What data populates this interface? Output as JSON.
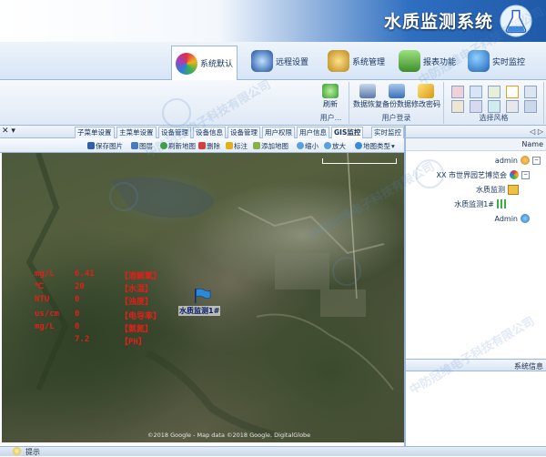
{
  "app": {
    "title": "水质监测系统"
  },
  "modules": [
    {
      "id": "realtime",
      "label": "实时监控",
      "icon": "globe-icon",
      "color": "#2e7fd8"
    },
    {
      "id": "report",
      "label": "报表功能",
      "icon": "report-icon",
      "color": "#4a9c3a"
    },
    {
      "id": "manage",
      "label": "系统管理",
      "icon": "manage-icon",
      "color": "#c89a20"
    },
    {
      "id": "remote",
      "label": "远程设置",
      "icon": "remote-icon",
      "color": "#2a5fb6"
    },
    {
      "id": "skin",
      "label": "系统默认",
      "icon": "palette-icon",
      "color": "#d0407a",
      "active": true
    }
  ],
  "ribbon": {
    "groups": [
      {
        "title": "选择风格"
      },
      {
        "title": "用户登录"
      },
      {
        "title": "用户..."
      }
    ],
    "buttons": [
      {
        "label": "修改密码",
        "icon": "key-icon"
      },
      {
        "label": "备份数据",
        "icon": "backup-icon"
      },
      {
        "label": "数据恢复",
        "icon": "restore-icon"
      },
      {
        "label": "刷新",
        "icon": "refresh-icon"
      }
    ]
  },
  "doc_tabs": [
    "GIS监控",
    "用户信息",
    "用户权限",
    "设备管理",
    "设备信息",
    "设备管理",
    "主菜单设置",
    "子菜单设置"
  ],
  "map_toolbar": [
    "地图类型",
    "放大",
    "缩小",
    "添加地图",
    "标注",
    "删除",
    "刷新地图",
    "图层",
    "保存图片"
  ],
  "tree": {
    "tabs": [
      "Name"
    ],
    "nodes": [
      {
        "label": "admin",
        "level": 0
      },
      {
        "label": "XX 市世界园艺博览会",
        "level": 1
      },
      {
        "label": "水质监测",
        "level": 2
      },
      {
        "label": "水质监测1#",
        "level": 3
      },
      {
        "label": "Admin",
        "level": 1
      }
    ],
    "sysinfo": "系统信息"
  },
  "map": {
    "station_name": "水质监测1#",
    "telemetry": [
      {
        "name": "【溶解氧】",
        "value": "6.41",
        "unit": "mg/L"
      },
      {
        "name": "【水温】",
        "value": "20",
        "unit": "℃"
      },
      {
        "name": "【浊度】",
        "value": "0",
        "unit": "NTU"
      },
      {
        "name": "【电导率】",
        "value": "0",
        "unit": "us/cm"
      },
      {
        "name": "【氨氮】",
        "value": "0",
        "unit": "mg/L"
      },
      {
        "name": "【PH】",
        "value": "7.2",
        "unit": ""
      }
    ],
    "copyright": "©2018 Google - Map data ©2018 Google, DigitalGlobe"
  },
  "statusbar": {
    "text": "提示"
  },
  "watermark": "中防冠维电子科技有限公司",
  "colors": {
    "title_blue": "#1f5aa8",
    "telemetry_red": "#e0201a",
    "station_blue": "#0a1c6e"
  }
}
